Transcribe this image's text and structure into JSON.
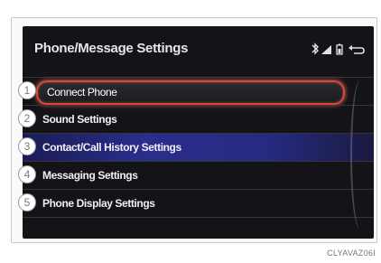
{
  "screen": {
    "title": "Phone/Message Settings",
    "status_icons": [
      "bluetooth-icon",
      "signal-strength-icon",
      "battery-icon",
      "back-icon"
    ]
  },
  "menu": {
    "items": [
      {
        "number": "1",
        "label": "Connect Phone"
      },
      {
        "number": "2",
        "label": "Sound Settings"
      },
      {
        "number": "3",
        "label": "Contact/Call History Settings"
      },
      {
        "number": "4",
        "label": "Messaging Settings"
      },
      {
        "number": "5",
        "label": "Phone Display Settings"
      }
    ]
  },
  "caption": "CLYAVAZ06I",
  "colors": {
    "screen_bg": "#141418",
    "selection_border": "#d84a3c",
    "highlight_band": "#2a2e8c"
  }
}
